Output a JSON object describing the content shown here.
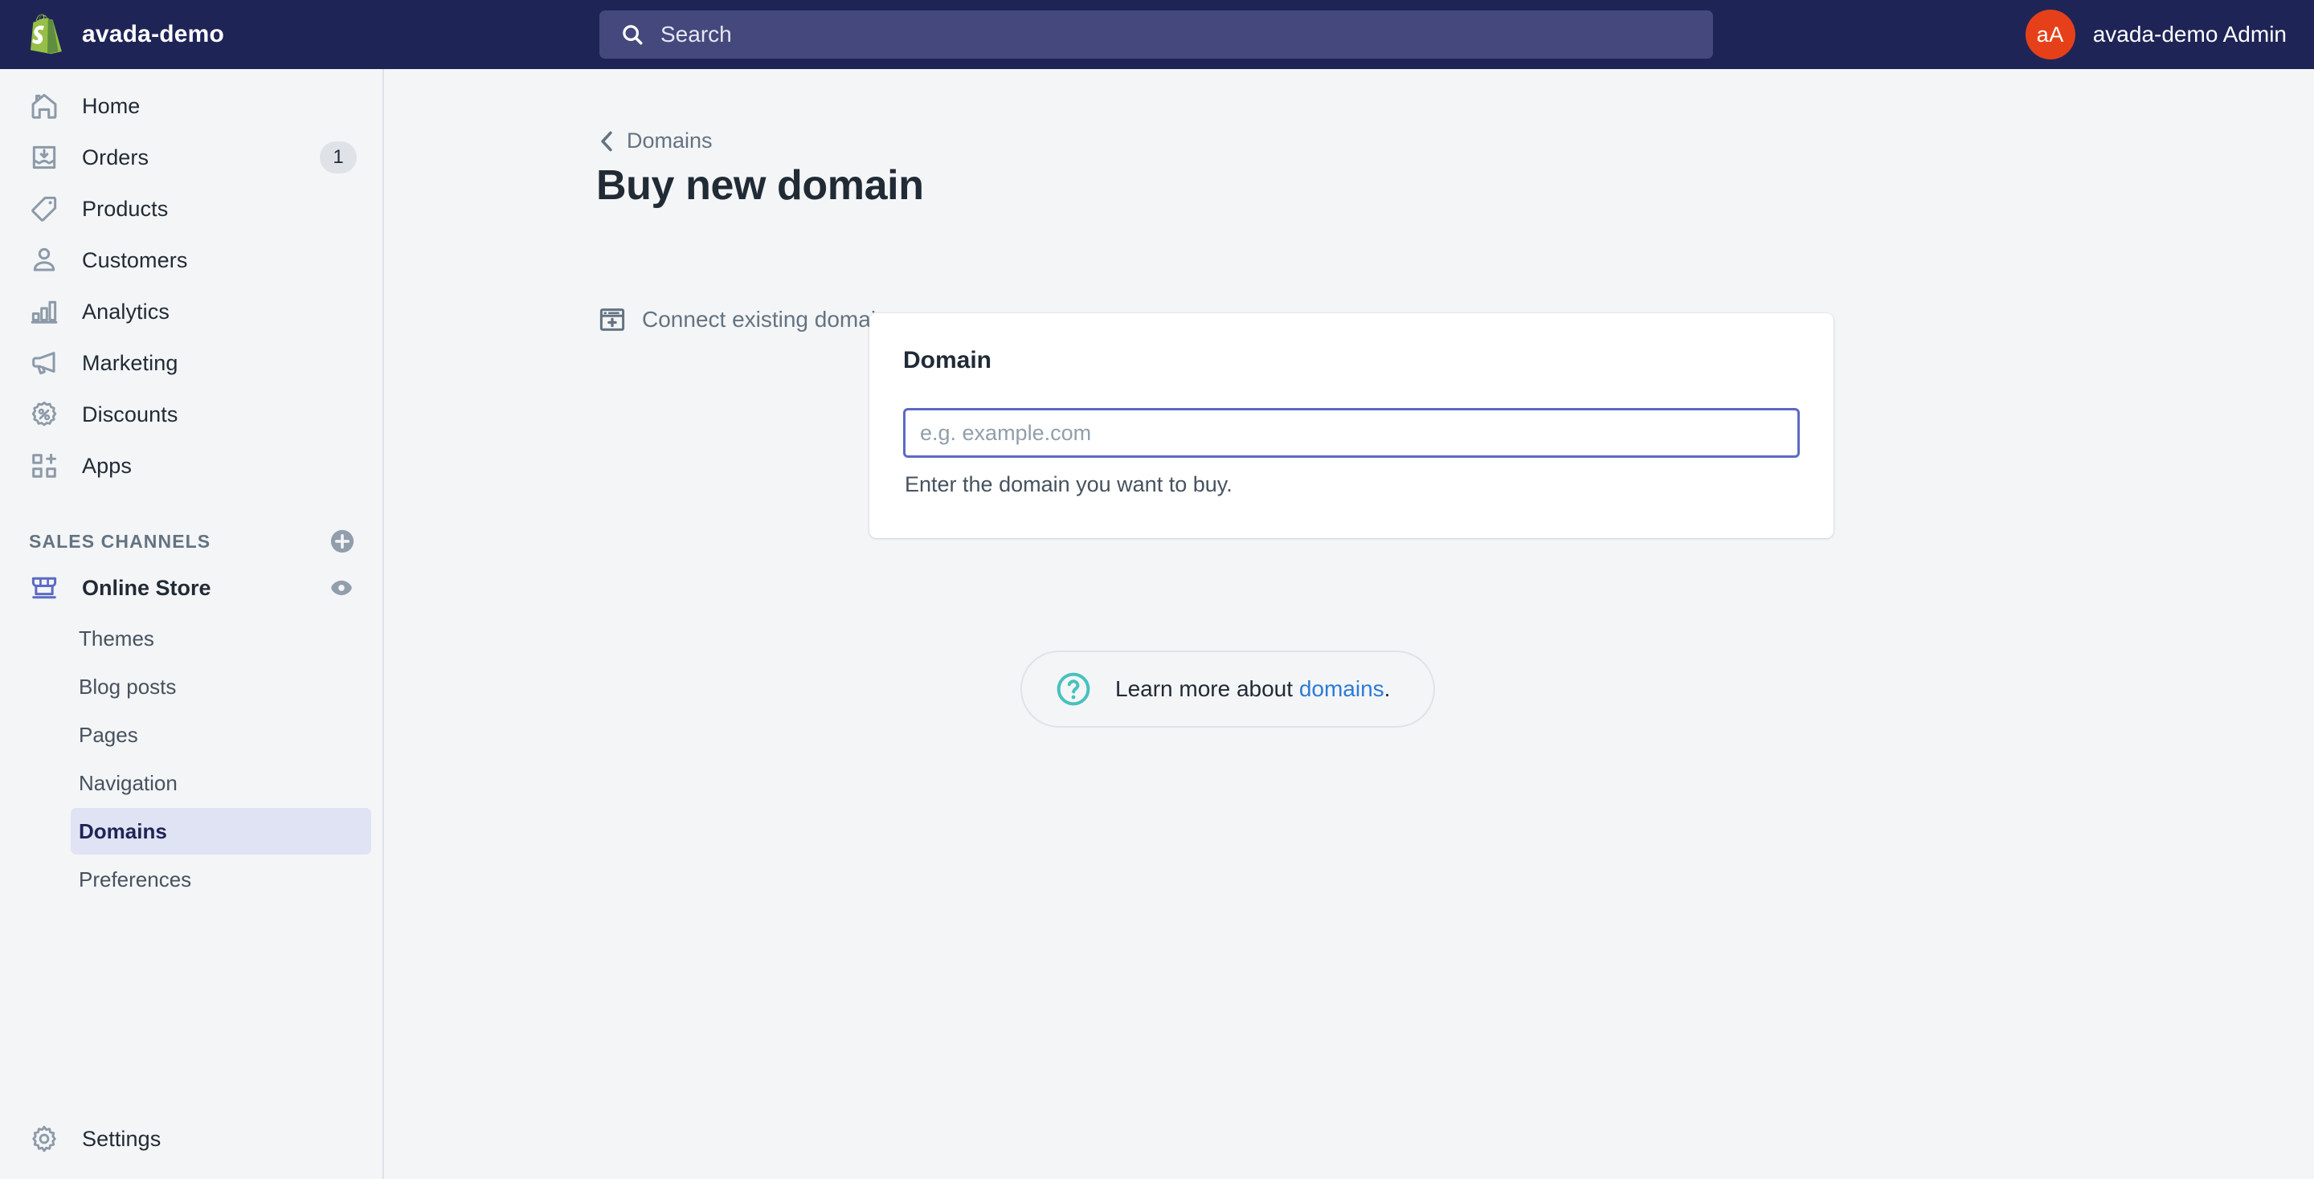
{
  "topbar": {
    "store_name": "avada-demo",
    "search_placeholder": "Search",
    "account": {
      "initials": "aA",
      "name": "avada-demo Admin"
    },
    "colors": {
      "bar": "#1f2457",
      "search_field": "#44487c",
      "avatar": "#e6401a"
    }
  },
  "sidebar": {
    "primary": [
      {
        "label": "Home",
        "icon": "home-icon",
        "badge": ""
      },
      {
        "label": "Orders",
        "icon": "orders-icon",
        "badge": "1"
      },
      {
        "label": "Products",
        "icon": "products-icon",
        "badge": ""
      },
      {
        "label": "Customers",
        "icon": "customers-icon",
        "badge": ""
      },
      {
        "label": "Analytics",
        "icon": "analytics-icon",
        "badge": ""
      },
      {
        "label": "Marketing",
        "icon": "marketing-icon",
        "badge": ""
      },
      {
        "label": "Discounts",
        "icon": "discounts-icon",
        "badge": ""
      },
      {
        "label": "Apps",
        "icon": "apps-icon",
        "badge": ""
      }
    ],
    "sales_channels": {
      "heading": "SALES CHANNELS",
      "add_icon": "circle-plus-icon",
      "channel": {
        "label": "Online Store",
        "icon": "storefront-icon",
        "view_icon": "eye-icon"
      },
      "sub_items": [
        {
          "label": "Themes",
          "active": false
        },
        {
          "label": "Blog posts",
          "active": false
        },
        {
          "label": "Pages",
          "active": false
        },
        {
          "label": "Navigation",
          "active": false
        },
        {
          "label": "Domains",
          "active": true
        },
        {
          "label": "Preferences",
          "active": false
        }
      ],
      "active_colors": {
        "background": "#dfe3f3",
        "text": "#1f2457"
      }
    },
    "settings": {
      "label": "Settings",
      "icon": "gear-icon"
    }
  },
  "main": {
    "breadcrumb": {
      "label": "Domains",
      "icon": "chevron-left-icon"
    },
    "title": "Buy new domain",
    "connect_existing": {
      "label": "Connect existing domain",
      "icon": "window-plus-icon"
    },
    "card": {
      "title": "Domain",
      "input_value": "",
      "input_placeholder": "e.g. example.com",
      "help_text": "Enter the domain you want to buy.",
      "focus_border_color": "#5c6ac4"
    },
    "help_pill": {
      "icon": "question-circle-icon",
      "text_before": "Learn more about ",
      "link_text": "domains",
      "text_after": ".",
      "link_color": "#2b7bd6"
    }
  }
}
